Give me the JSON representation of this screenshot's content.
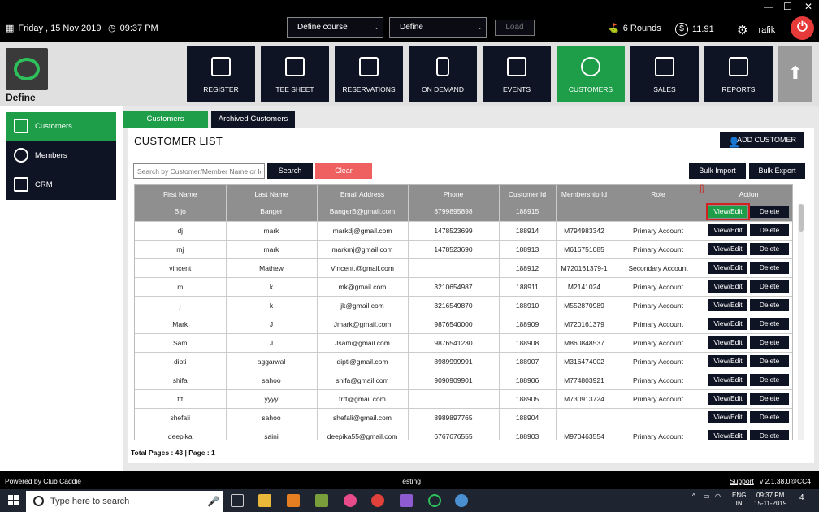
{
  "window": {
    "minimize": "—",
    "maximize": "☐",
    "close": "✕"
  },
  "topbar": {
    "date": "Friday ,  15 Nov 2019",
    "time": "09:37 PM",
    "course_select": "Define  course",
    "define_select": "Define",
    "load_label": "Load",
    "rounds": "6 Rounds",
    "balance": "11.91",
    "user": "rafik"
  },
  "brand": {
    "name": "Define"
  },
  "nav": [
    {
      "label": "REGISTER",
      "icon": "scanner-icon"
    },
    {
      "label": "TEE SHEET",
      "icon": "calendar-icon"
    },
    {
      "label": "RESERVATIONS",
      "icon": "calendar-icon"
    },
    {
      "label": "ON DEMAND",
      "icon": "phone-icon"
    },
    {
      "label": "EVENTS",
      "icon": "calendar-grid-icon"
    },
    {
      "label": "CUSTOMERS",
      "icon": "users-icon"
    },
    {
      "label": "SALES",
      "icon": "money-icon"
    },
    {
      "label": "REPORTS",
      "icon": "report-icon"
    }
  ],
  "sidebar": {
    "items": [
      {
        "label": "Customers"
      },
      {
        "label": "Members"
      },
      {
        "label": "CRM"
      }
    ]
  },
  "tabs": {
    "customers": "Customers",
    "archived": "Archived Customers"
  },
  "main": {
    "title": "CUSTOMER LIST",
    "add_label": "ADD CUSTOMER",
    "search_placeholder": "Search by Customer/Member Name or Id",
    "search_label": "Search",
    "clear_label": "Clear",
    "bulk_import": "Bulk Import",
    "bulk_export": "Bulk Export",
    "columns": [
      "First Name",
      "Last Name",
      "Email Address",
      "Phone",
      "Customer Id",
      "Membership Id",
      "Role",
      "Action"
    ],
    "view_label": "View/Edit",
    "delete_label": "Delete",
    "rows": [
      [
        "Bijo",
        "Banger",
        "BangerB@gmail.com",
        "8799895898",
        "188915",
        "",
        ""
      ],
      [
        "dj",
        "mark",
        "markdj@gmail.com",
        "1478523699",
        "188914",
        "M794983342",
        "Primary Account"
      ],
      [
        "mj",
        "mark",
        "markmj@gmail.com",
        "1478523690",
        "188913",
        "M616751085",
        "Primary Account"
      ],
      [
        "vincent",
        "Mathew",
        "Vincent.@gmail.com",
        "",
        "188912",
        "M720161379-1",
        "Secondary Account"
      ],
      [
        "m",
        "k",
        "mk@gmail.com",
        "3210654987",
        "188911",
        "M2141024",
        "Primary Account"
      ],
      [
        "j",
        "k",
        "jk@gmail.com",
        "3216549870",
        "188910",
        "M552870989",
        "Primary Account"
      ],
      [
        "Mark",
        "J",
        "Jmark@gmail.com",
        "9876540000",
        "188909",
        "M720161379",
        "Primary Account"
      ],
      [
        "Sam",
        "J",
        "Jsam@gmail.com",
        "9876541230",
        "188908",
        "M860848537",
        "Primary Account"
      ],
      [
        "dipti",
        "aggarwal",
        "dipti@gmail.com",
        "8989999991",
        "188907",
        "M316474002",
        "Primary Account"
      ],
      [
        "shifa",
        "sahoo",
        "shifa@gmail.com",
        "9090909901",
        "188906",
        "M774803921",
        "Primary Account"
      ],
      [
        "ttt",
        "yyyy",
        "trrt@gmail.com",
        "",
        "188905",
        "M730913724",
        "Primary Account"
      ],
      [
        "shefali",
        "sahoo",
        "shefali@gmail.com",
        "8989897765",
        "188904",
        "",
        ""
      ],
      [
        "deepika",
        "saini",
        "deepika55@gmail.com",
        "6767676555",
        "188903",
        "M970463554",
        "Primary Account"
      ]
    ],
    "totals": "Total Pages : 43 | Page : 1"
  },
  "footer": {
    "powered": "Powered by Club Caddie",
    "env": "Testing",
    "support": "Support",
    "version": "v 2.1.38.0@CC4"
  },
  "taskbar": {
    "search_placeholder": "Type here to search",
    "lang": "ENG",
    "region": "IN",
    "time": "09:37 PM",
    "date": "15-11-2019",
    "notifications": "4"
  }
}
